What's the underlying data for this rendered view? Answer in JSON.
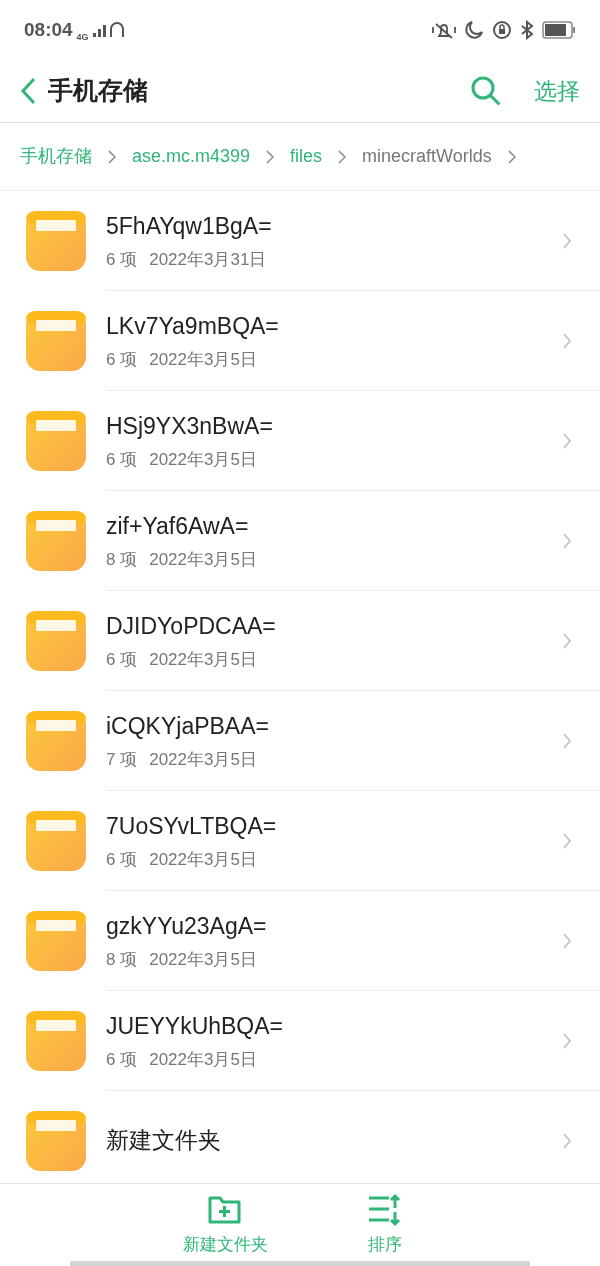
{
  "status_bar": {
    "time": "08:04",
    "network": "4G"
  },
  "header": {
    "title": "手机存储",
    "action": "选择"
  },
  "breadcrumbs": [
    {
      "label": "手机存储",
      "current": false
    },
    {
      "label": "ase.mc.m4399",
      "current": false
    },
    {
      "label": "files",
      "current": false
    },
    {
      "label": "minecraftWorlds",
      "current": true
    }
  ],
  "folders": [
    {
      "name": "5FhAYqw1BgA=",
      "count": "6 项",
      "date": "2022年3月31日"
    },
    {
      "name": "LKv7Ya9mBQA=",
      "count": "6 项",
      "date": "2022年3月5日"
    },
    {
      "name": "HSj9YX3nBwA=",
      "count": "6 项",
      "date": "2022年3月5日"
    },
    {
      "name": "zif+Yaf6AwA=",
      "count": "8 项",
      "date": "2022年3月5日"
    },
    {
      "name": "DJIDYoPDCAA=",
      "count": "6 项",
      "date": "2022年3月5日"
    },
    {
      "name": "iCQKYjaPBAA=",
      "count": "7 项",
      "date": "2022年3月5日"
    },
    {
      "name": "7UoSYvLTBQA=",
      "count": "6 项",
      "date": "2022年3月5日"
    },
    {
      "name": "gzkYYu23AgA=",
      "count": "8 项",
      "date": "2022年3月5日"
    },
    {
      "name": "JUEYYkUhBQA=",
      "count": "6 项",
      "date": "2022年3月5日"
    },
    {
      "name": "新建文件夹"
    }
  ],
  "toolbar": [
    {
      "kind": "new-folder",
      "label": "新建文件夹"
    },
    {
      "kind": "sort",
      "label": "排序"
    }
  ]
}
